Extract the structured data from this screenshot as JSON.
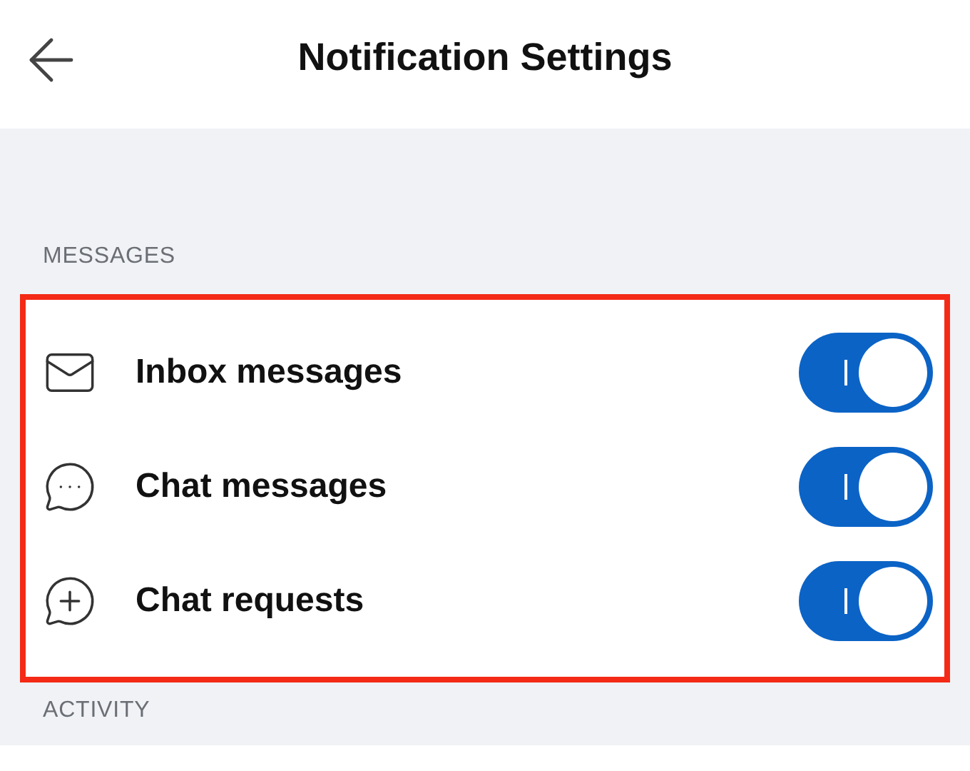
{
  "header": {
    "title": "Notification Settings"
  },
  "sections": [
    {
      "heading": "MESSAGES",
      "rows": [
        {
          "label": "Inbox messages",
          "on": true
        },
        {
          "label": "Chat messages",
          "on": true
        },
        {
          "label": "Chat requests",
          "on": true
        }
      ]
    },
    {
      "heading": "ACTIVITY"
    }
  ]
}
